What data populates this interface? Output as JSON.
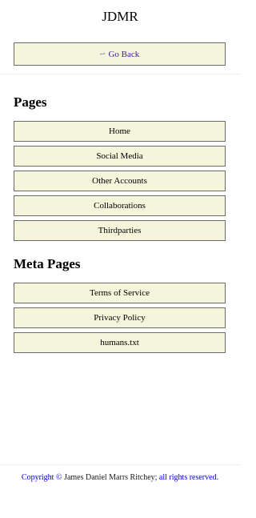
{
  "header": {
    "title": "JDMR"
  },
  "back_button": {
    "icon": "↩",
    "label": "Go Back"
  },
  "pages_section": {
    "heading": "Pages",
    "items": [
      "Home",
      "Social Media",
      "Other Accounts",
      "Collaborations",
      "Thirdparties"
    ]
  },
  "meta_section": {
    "heading": "Meta Pages",
    "items": [
      "Terms of Service",
      "Privacy Policy",
      "humans.txt"
    ]
  },
  "footer": {
    "prefix": "Copyright © ",
    "owner": "James Daniel Marrs Ritchey",
    "suffix": "; all rights reserved."
  },
  "colors": {
    "button_background": "#f5f5dc",
    "button_border": "#6b6b6b",
    "footer_link": "#0000cc"
  }
}
